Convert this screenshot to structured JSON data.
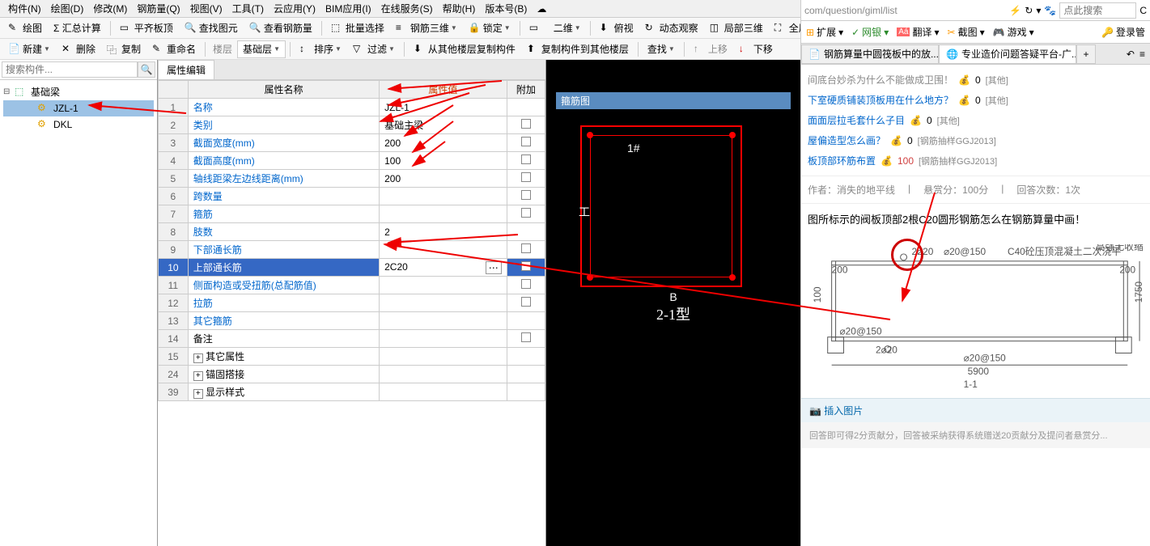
{
  "menu": {
    "items": [
      "构件(N)",
      "绘图(D)",
      "修改(M)",
      "钢筋量(Q)",
      "视图(V)",
      "工具(T)",
      "云应用(Y)",
      "BIM应用(I)",
      "在线服务(S)",
      "帮助(H)",
      "版本号(B)"
    ],
    "login": "登录"
  },
  "toolbar1": {
    "draw": "绘图",
    "sum": "Σ 汇总计算",
    "plane": "平齐板顶",
    "find_view": "查找图元",
    "check_steel": "查看钢筋量",
    "batch_select": "批量选择",
    "steel_3d": "钢筋三维",
    "lock": "锁定",
    "dim2d": "二维",
    "overview": "俯视",
    "dyn_view": "动态观察",
    "local_3d": "局部三维",
    "fullscreen": "全屏"
  },
  "toolbar2": {
    "new": "新建",
    "delete": "删除",
    "copy": "复制",
    "rename": "重命名",
    "floors": "楼层",
    "base_floor": "基础层",
    "sort": "排序",
    "filter": "过滤",
    "copy_from": "从其他楼层复制构件",
    "copy_to": "复制构件到其他楼层",
    "find": "查找",
    "upload": "上移",
    "download": "下移"
  },
  "search_placeholder": "搜索构件...",
  "tree": {
    "root": "基础梁",
    "children": [
      "JZL-1",
      "DKL"
    ]
  },
  "panel_title": "属性编辑",
  "prop_headers": {
    "name": "属性名称",
    "value": "属性值",
    "addon": "附加"
  },
  "props": [
    {
      "n": "1",
      "name": "名称",
      "value": "JZL-1",
      "blue": true,
      "cb": false
    },
    {
      "n": "2",
      "name": "类别",
      "value": "基础主梁",
      "blue": true,
      "cb": true
    },
    {
      "n": "3",
      "name": "截面宽度(mm)",
      "value": "200",
      "blue": true,
      "cb": true
    },
    {
      "n": "4",
      "name": "截面高度(mm)",
      "value": "100",
      "blue": true,
      "cb": true
    },
    {
      "n": "5",
      "name": "轴线距梁左边线距离(mm)",
      "value": "200",
      "blue": true,
      "cb": true
    },
    {
      "n": "6",
      "name": "跨数量",
      "value": "",
      "blue": true,
      "cb": true
    },
    {
      "n": "7",
      "name": "箍筋",
      "value": "",
      "blue": true,
      "cb": true
    },
    {
      "n": "8",
      "name": "肢数",
      "value": "2",
      "blue": true,
      "cb": false
    },
    {
      "n": "9",
      "name": "下部通长筋",
      "value": "",
      "blue": true,
      "cb": true
    },
    {
      "n": "10",
      "name": "上部通长筋",
      "value": "2C20",
      "blue": true,
      "cb": true,
      "selected": true
    },
    {
      "n": "11",
      "name": "侧面构造或受扭筋(总配筋值)",
      "value": "",
      "blue": true,
      "cb": true
    },
    {
      "n": "12",
      "name": "拉筋",
      "value": "",
      "blue": true,
      "cb": true
    },
    {
      "n": "13",
      "name": "其它箍筋",
      "value": "",
      "blue": true,
      "cb": false
    },
    {
      "n": "14",
      "name": "备注",
      "value": "",
      "blue": false,
      "cb": true
    },
    {
      "n": "15",
      "name": "其它属性",
      "value": "",
      "blue": false,
      "exp": true
    },
    {
      "n": "24",
      "name": "锚固搭接",
      "value": "",
      "blue": false,
      "exp": true
    },
    {
      "n": "39",
      "name": "显示样式",
      "value": "",
      "blue": false,
      "exp": true
    }
  ],
  "guji": {
    "title": "箍筋图",
    "label1": "1#",
    "labelg": "工",
    "labelB": "B",
    "labelType": "2-1型"
  },
  "browser": {
    "url": "com/question/giml/list",
    "search_ph": "点此搜索",
    "ext": {
      "expand": "扩展",
      "bank": "网银",
      "translate": "翻译",
      "screenshot": "截图",
      "game": "游戏",
      "loginmgr": "登录管"
    },
    "tabs": [
      "钢筋算量中圆筏板中的放...",
      "专业造价问题答疑平台-广..."
    ],
    "qa": [
      {
        "title": "下室硬质铺装顶板用在什么地方？",
        "coin": "0",
        "cat": "[其他]"
      },
      {
        "title": "面面层拉毛套什么子目",
        "coin": "0",
        "cat": "[其他]"
      },
      {
        "title": "屋偏造型怎么画？",
        "coin": "0",
        "cat": "[钢筋抽样GGJ2013]"
      },
      {
        "title": "板顶部环筋布置",
        "coin": "100",
        "cat": "[钢筋抽样GGJ2013]"
      }
    ],
    "qa0_partial": "间底台妙杀为什么不能做成卫围！",
    "qa0_coin": "0",
    "qa0_cat": "[其他]",
    "info": {
      "author_label": "作者：",
      "author": "消失的地平线",
      "bounty_label": "悬赏分：",
      "bounty": "100分",
      "answers_label": "回答次数：",
      "answers": "1次"
    },
    "body": "图所标示的阀板顶部2根C20圆形钢筋怎么在钢筋算量中画！",
    "diag": {
      "label_1_1": "1-1",
      "dim_5900": "5900",
      "dim_1750": "1750",
      "dim_200": "200",
      "dim_100": "100",
      "rebar": "2⌀20",
      "spacing1": "⌀20@150",
      "spacing2": "⌀20@150",
      "note": "C40砼压顶混凝土二次浇平",
      "note2": "高强无收缩灌浆料"
    },
    "insert_pic": "插入图片",
    "footer": "回答即可得2分贡献分，回答被采纳获得系统赠送20贡献分及提问者悬赏分..."
  }
}
